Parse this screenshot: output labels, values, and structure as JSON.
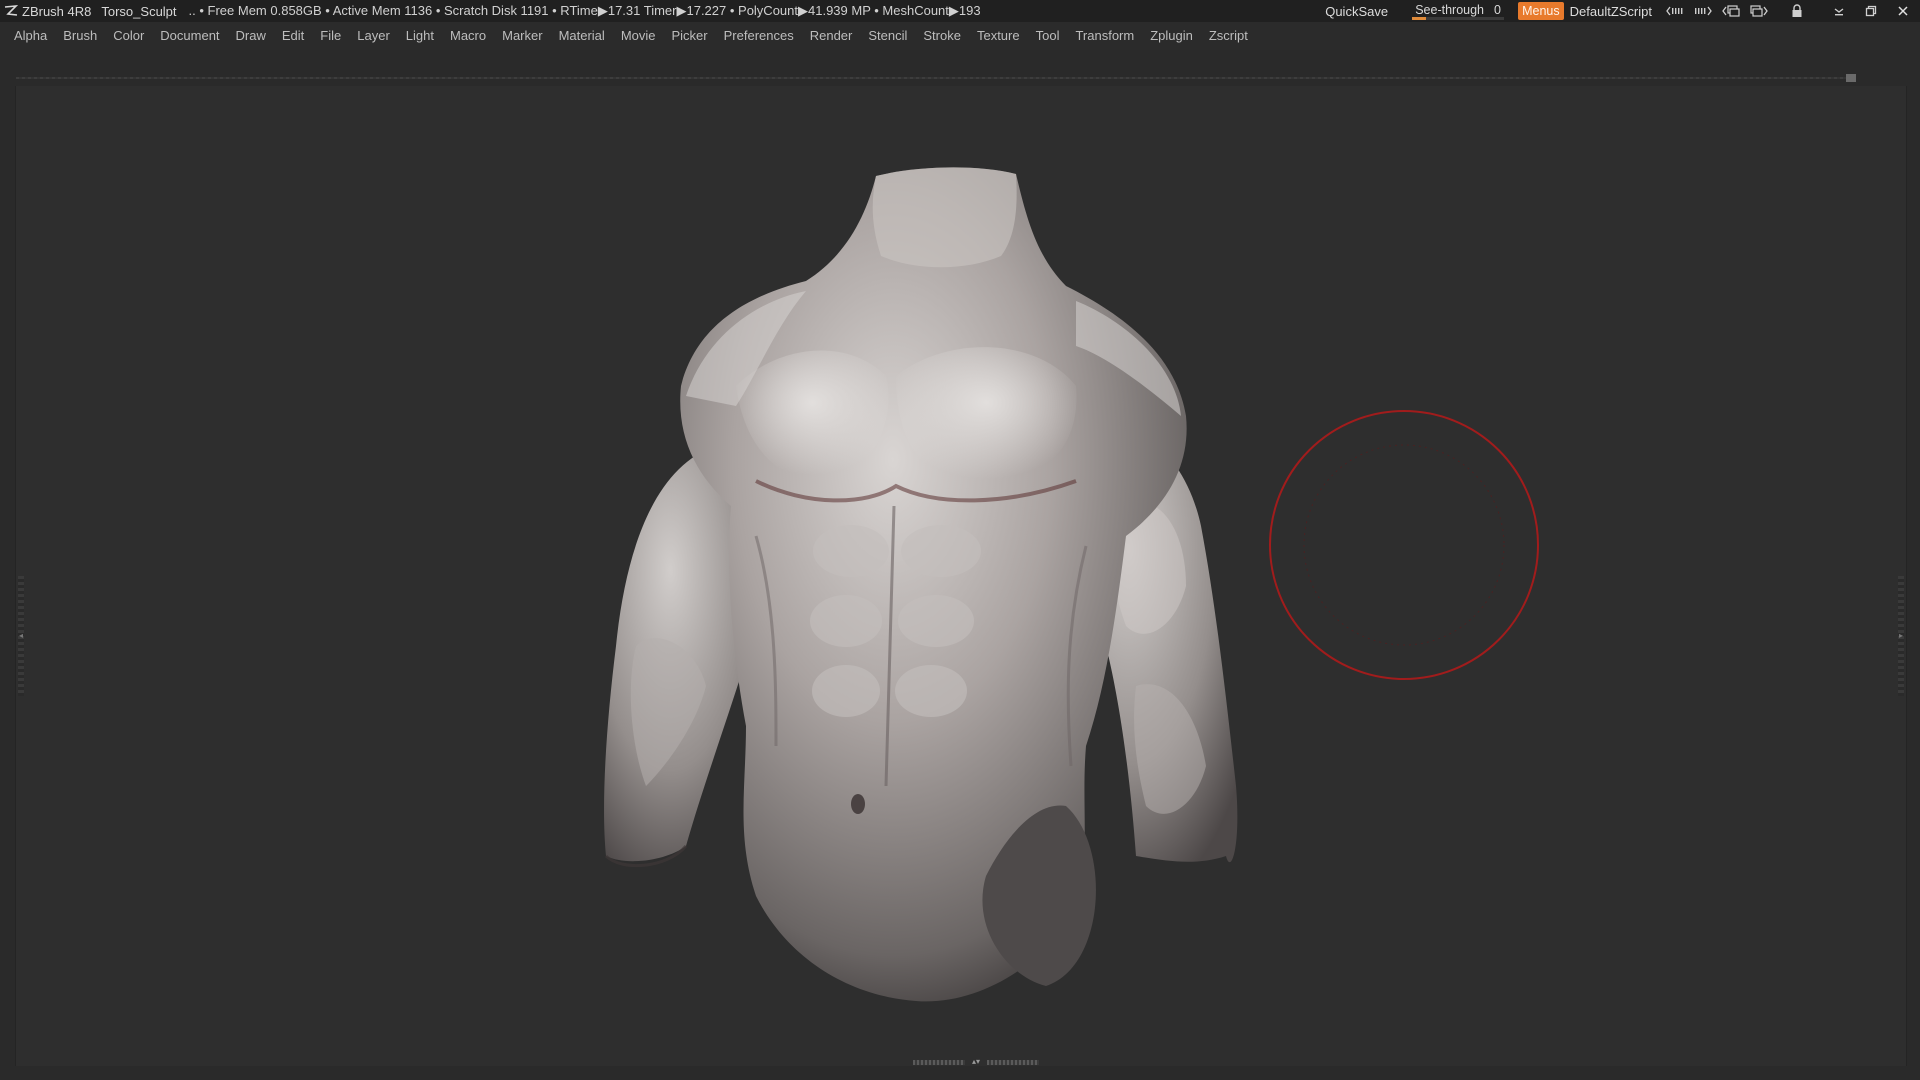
{
  "titlebar": {
    "app_name": "ZBrush 4R8",
    "project_name": "Torso_Sculpt",
    "stats_text": ".. • Free Mem 0.858GB • Active Mem 1136 • Scratch Disk 1191 •  RTime▶17.31 Timer▶17.227 • PolyCount▶41.939 MP  • MeshCount▶193",
    "quicksave_label": "QuickSave",
    "seethrough_label": "See-through",
    "seethrough_value": "0",
    "seethrough_fraction": 0.0,
    "menus_label": "Menus",
    "script_label": "DefaultZScript",
    "accent_color": "#e87a2c",
    "icons": [
      "zbrush-logo-icon",
      "layout-prev-icon",
      "layout-next-icon",
      "colors-prev-icon",
      "colors-next-icon",
      "lock-icon",
      "minimize-icon",
      "restore-icon",
      "close-icon"
    ]
  },
  "menubar": {
    "items": [
      "Alpha",
      "Brush",
      "Color",
      "Document",
      "Draw",
      "Edit",
      "File",
      "Layer",
      "Light",
      "Macro",
      "Marker",
      "Material",
      "Movie",
      "Picker",
      "Preferences",
      "Render",
      "Stencil",
      "Stroke",
      "Texture",
      "Tool",
      "Transform",
      "Zplugin",
      "Zscript"
    ]
  },
  "canvas": {
    "background": "#2e2e2e",
    "model": "male torso sculpt",
    "brush_cursor_color": "#a11c1c"
  }
}
